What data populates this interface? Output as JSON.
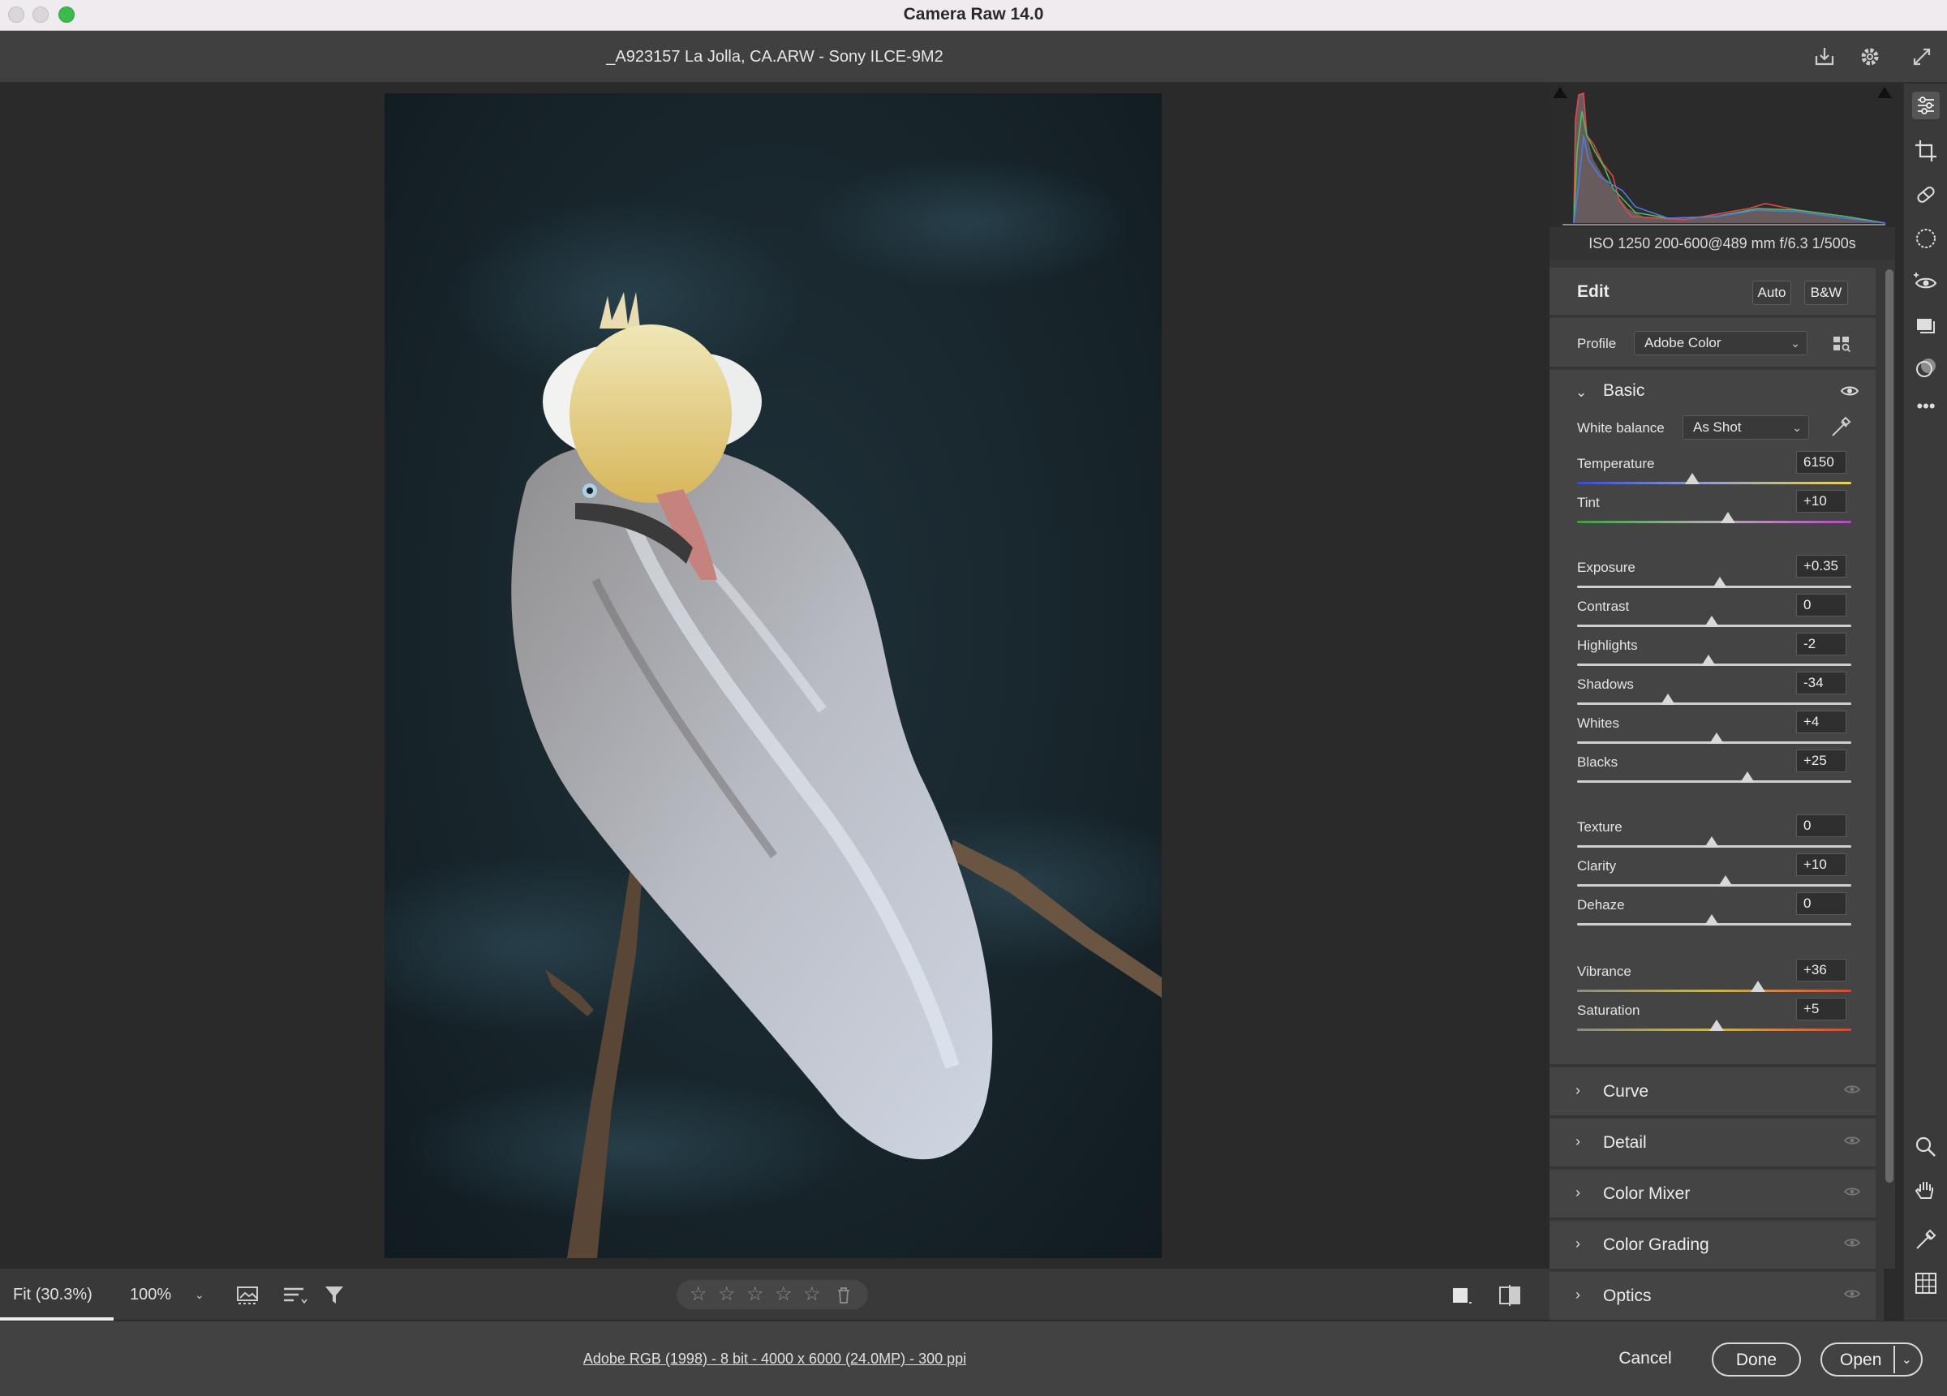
{
  "window": {
    "title": "Camera Raw 14.0"
  },
  "file": {
    "name": "_A923157 La Jolla, CA.ARW  -  Sony ILCE-9M2"
  },
  "exif": {
    "text": "ISO 1250   200-600@489 mm   f/6.3   1/500s"
  },
  "edit": {
    "title": "Edit",
    "auto_label": "Auto",
    "bw_label": "B&W"
  },
  "profile": {
    "label": "Profile",
    "value": "Adobe Color"
  },
  "basic": {
    "title": "Basic",
    "wb_label": "White balance",
    "wb_value": "As Shot",
    "sliders": [
      {
        "label": "Temperature",
        "value": "6150",
        "pos": 0.42
      },
      {
        "label": "Tint",
        "value": "+10",
        "pos": 0.55
      },
      {
        "label": "Exposure",
        "value": "+0.35",
        "pos": 0.52
      },
      {
        "label": "Contrast",
        "value": "0",
        "pos": 0.49
      },
      {
        "label": "Highlights",
        "value": "-2",
        "pos": 0.48
      },
      {
        "label": "Shadows",
        "value": "-34",
        "pos": 0.33
      },
      {
        "label": "Whites",
        "value": "+4",
        "pos": 0.51
      },
      {
        "label": "Blacks",
        "value": "+25",
        "pos": 0.62
      },
      {
        "label": "Texture",
        "value": "0",
        "pos": 0.49
      },
      {
        "label": "Clarity",
        "value": "+10",
        "pos": 0.54
      },
      {
        "label": "Dehaze",
        "value": "0",
        "pos": 0.49
      },
      {
        "label": "Vibrance",
        "value": "+36",
        "pos": 0.66
      },
      {
        "label": "Saturation",
        "value": "+5",
        "pos": 0.51
      }
    ]
  },
  "sections": [
    "Curve",
    "Detail",
    "Color Mixer",
    "Color Grading",
    "Optics"
  ],
  "bottombar": {
    "fit": "Fit (30.3%)",
    "zoom": "100%"
  },
  "footer": {
    "workflow": "Adobe RGB (1998) - 8 bit - 4000 x 6000 (24.0MP) - 300 ppi",
    "cancel": "Cancel",
    "done": "Done",
    "open": "Open"
  },
  "colors": {
    "accent": "#1473e6",
    "panel": "#444444",
    "bg": "#2b2b2b"
  }
}
